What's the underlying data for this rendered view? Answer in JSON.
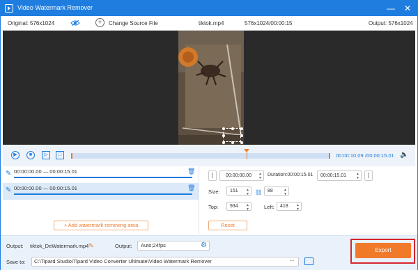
{
  "window": {
    "title": "Video Watermark Remover",
    "minimize_glyph": "—",
    "close_glyph": "✕"
  },
  "infobar": {
    "original_label": "Original: 576x1024",
    "change_source_label": "Change Source File",
    "file_name": "tiktok.mp4",
    "file_meta": "576x1024/00:00:15",
    "output_label": "Output: 576x1024"
  },
  "playback": {
    "current_time": "00:00:10.09",
    "total_time": "/00:00:15.01",
    "progress": 0.68
  },
  "segments": [
    {
      "range": "00:00:00.00 — 00:00:15.01",
      "selected": false
    },
    {
      "range": "00:00:00.00 — 00:00:15.01",
      "selected": true
    }
  ],
  "add_area_label": "+ Add watermark removing area",
  "settings": {
    "start_time": "00:00:00.00",
    "duration": "Duration:00:00:15.01",
    "end_time": "00:00:15.01",
    "size_label": "Size:",
    "width": "151",
    "height": "88",
    "top_label": "Top:",
    "top": "934",
    "left_label": "Left:",
    "left": "418",
    "reset_label": "Reset"
  },
  "bottom": {
    "output_label": "Output:",
    "output_file": "tiktok_DeWatermark.mp4",
    "output_format_label": "Output:",
    "output_format": "Auto;24fps",
    "save_to_label": "Save to:",
    "save_path": "C:\\Tipard Studio\\Tipard Video Converter Ultimate\\Video Watermark Remover",
    "browse_label": "···",
    "export_label": "Export"
  },
  "colors": {
    "accent": "#1f7de0",
    "orange": "#f07a2a",
    "highlight_border": "#d6252f"
  }
}
